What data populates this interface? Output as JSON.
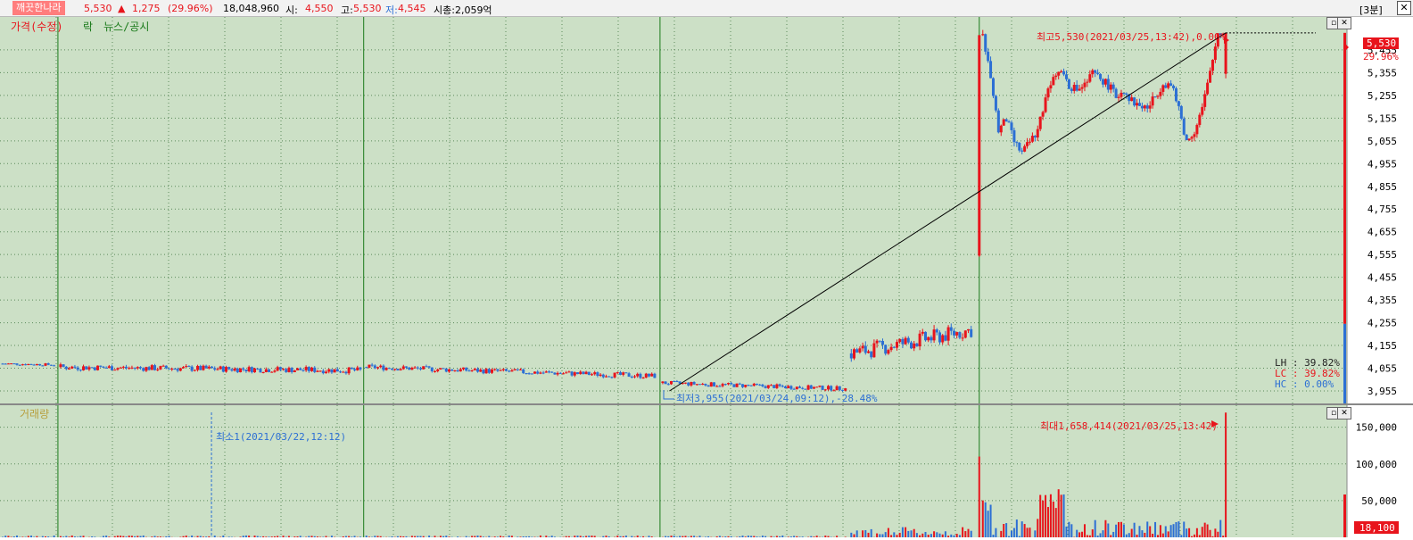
{
  "topbar": {
    "name": "깨끗한나라",
    "price": "5,530",
    "change_arrow": "▲",
    "change": "1,275",
    "change_pct": "(29.96%)",
    "volume": "18,048,960",
    "open_label": "시:",
    "open": "4,550",
    "high_label": "고:",
    "high": "5,530",
    "low_label": "저:",
    "low": "4,545",
    "mcap": "시총:2,059억",
    "period": "[3분]",
    "close_icon": "close-icon"
  },
  "price_panel": {
    "legend_price": "가격(수정)",
    "legend_lock": "락",
    "legend_news": "뉴스/공시",
    "max_annotation": "최고5,530(2021/03/25,13:42),0.00%",
    "min_annotation": "최저3,955(2021/03/24,09:12),-28.48%",
    "current_price_tag": "5,530",
    "current_pct_tag": "29.96%",
    "lh": "LH : 39.82%",
    "lc": "LC : 39.82%",
    "hc": "HC :  0.00%"
  },
  "volume_panel": {
    "legend": "거래량",
    "min_annotation": "최소1(2021/03/22,12:12)",
    "max_annotation": "최대1,658,414(2021/03/25,13:42)",
    "current_volume_tag": "18,100"
  },
  "colors": {
    "background": "#cce0c6",
    "grid": "#5b8a5b",
    "up": "#e8141c",
    "down": "#2c6fd4",
    "session_divider": "#1a7a1a",
    "axis_bg": "#ffffff"
  },
  "chart_data": [
    {
      "type": "candlestick",
      "title": "",
      "ylim": [
        3900,
        5600
      ],
      "y_ticks": [
        5455,
        5355,
        5255,
        5155,
        5055,
        4955,
        4855,
        4755,
        4655,
        4555,
        4455,
        4355,
        4255,
        4155,
        4055,
        3955
      ],
      "y_tick_labels": [
        "5,455",
        "5,355",
        "5,255",
        "5,155",
        "5,055",
        "4,955",
        "4,855",
        "4,755",
        "4,655",
        "4,555",
        "4,455",
        "4,355",
        "4,255",
        "4,155",
        "4,055",
        "3,955"
      ],
      "sessions": [
        {
          "from": 0.0,
          "to": 0.043,
          "start": 4075,
          "end": 4070,
          "noise": 6,
          "drift": 0
        },
        {
          "from": 0.043,
          "to": 0.27,
          "start": 4060,
          "end": 4045,
          "noise": 14,
          "drift": 0
        },
        {
          "from": 0.27,
          "to": 0.49,
          "start": 4060,
          "end": 4020,
          "noise": 12,
          "drift": 0
        },
        {
          "from": 0.49,
          "to": 0.63,
          "start": 3990,
          "end": 3965,
          "noise": 10,
          "drift": 0
        },
        {
          "from": 0.63,
          "to": 0.725,
          "start": 4120,
          "end": 4225,
          "noise": 35,
          "drift": 0
        }
      ],
      "spike_open": {
        "x": 0.727,
        "open": 4550,
        "high": 5520,
        "low": 4545
      },
      "last_session": [
        5520,
        5350,
        5100,
        5150,
        5050,
        5000,
        5050,
        5100,
        5250,
        5350,
        5380,
        5300,
        5280,
        5300,
        5350,
        5330,
        5300,
        5250,
        5280,
        5230,
        5210,
        5200,
        5250,
        5310,
        5300,
        5200,
        5050,
        5100,
        5200,
        5350,
        5530
      ],
      "last_session_range": [
        0.727,
        0.91
      ],
      "trendline": {
        "x1": 0.497,
        "y1": 3955,
        "x2": 0.91,
        "y2": 5530
      },
      "max_point": {
        "x": 0.91,
        "y": 5530
      },
      "min_point": {
        "x": 0.497,
        "y": 3955
      }
    },
    {
      "type": "bar",
      "title": "",
      "ylim": [
        0,
        180000
      ],
      "y_ticks": [
        150000,
        100000,
        50000
      ],
      "y_tick_labels": [
        "150,000",
        "100,000",
        "50,000"
      ],
      "max_point": {
        "x": 0.91,
        "value": 1658414
      },
      "min_point": {
        "x": 0.157,
        "value": 1
      }
    }
  ]
}
